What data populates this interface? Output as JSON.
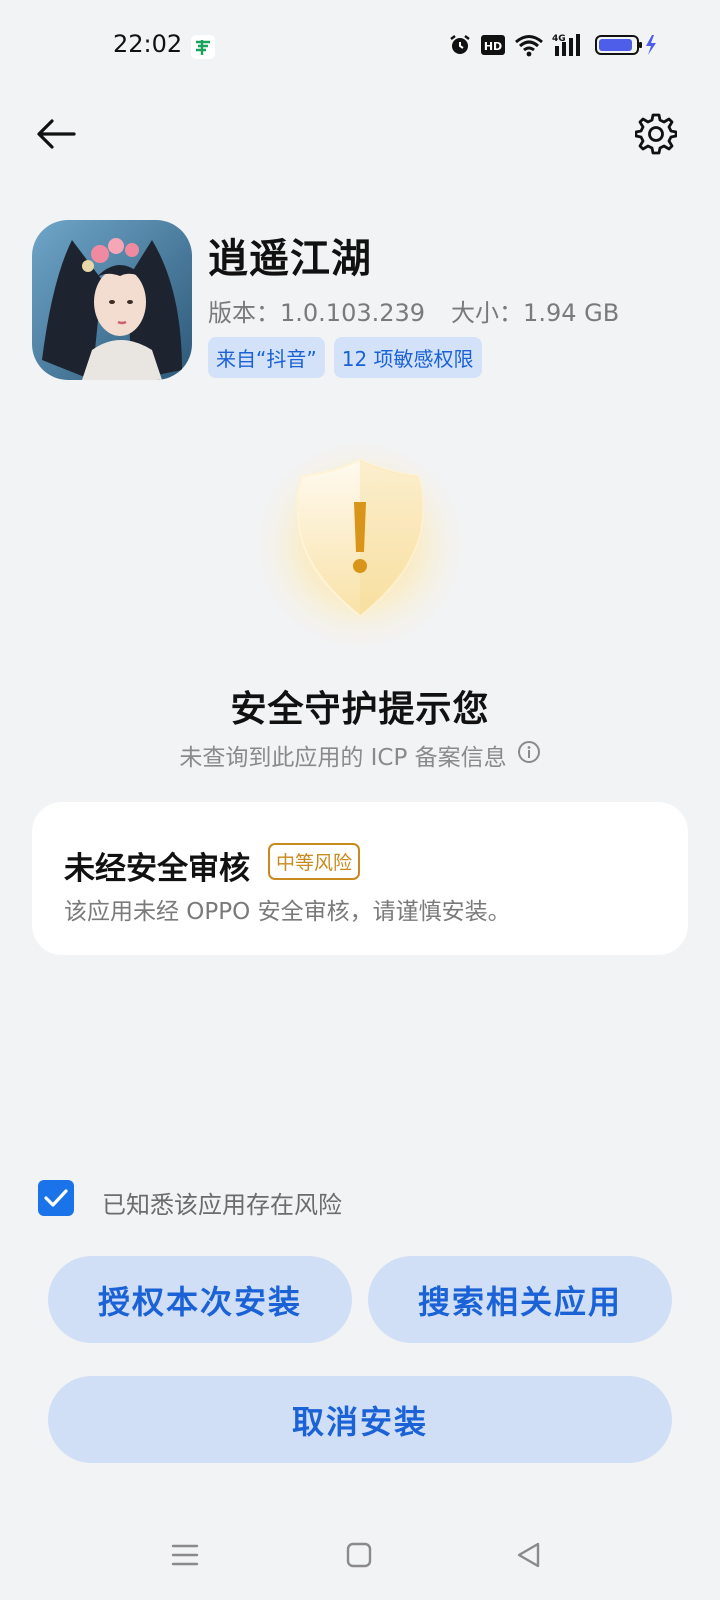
{
  "status_bar": {
    "time": "22:02",
    "battery_icon": "battery-charging-icon",
    "network_label": "4G",
    "hd_label": "HD"
  },
  "app": {
    "name": "逍遥江湖",
    "version_label": "版本：1.0.103.239",
    "size_label": "大小：1.94 GB",
    "tags": [
      "来自“抖音”",
      "12 项敏感权限"
    ]
  },
  "warning": {
    "title": "安全守护提示您",
    "subtitle": "未查询到此应用的 ICP 备案信息"
  },
  "risk": {
    "title": "未经安全审核",
    "badge": "中等风险",
    "description": "该应用未经 OPPO 安全审核，请谨慎安装。"
  },
  "acknowledge": {
    "label": "已知悉该应用存在风险",
    "checked": true
  },
  "buttons": {
    "authorize": "授权本次安装",
    "search": "搜索相关应用",
    "cancel": "取消安装"
  },
  "colors": {
    "accent": "#1a73e8",
    "button_bg": "#d0dff6",
    "button_text": "#1a62d6",
    "risk_badge": "#c98a1e",
    "background": "#f2f3f5"
  }
}
